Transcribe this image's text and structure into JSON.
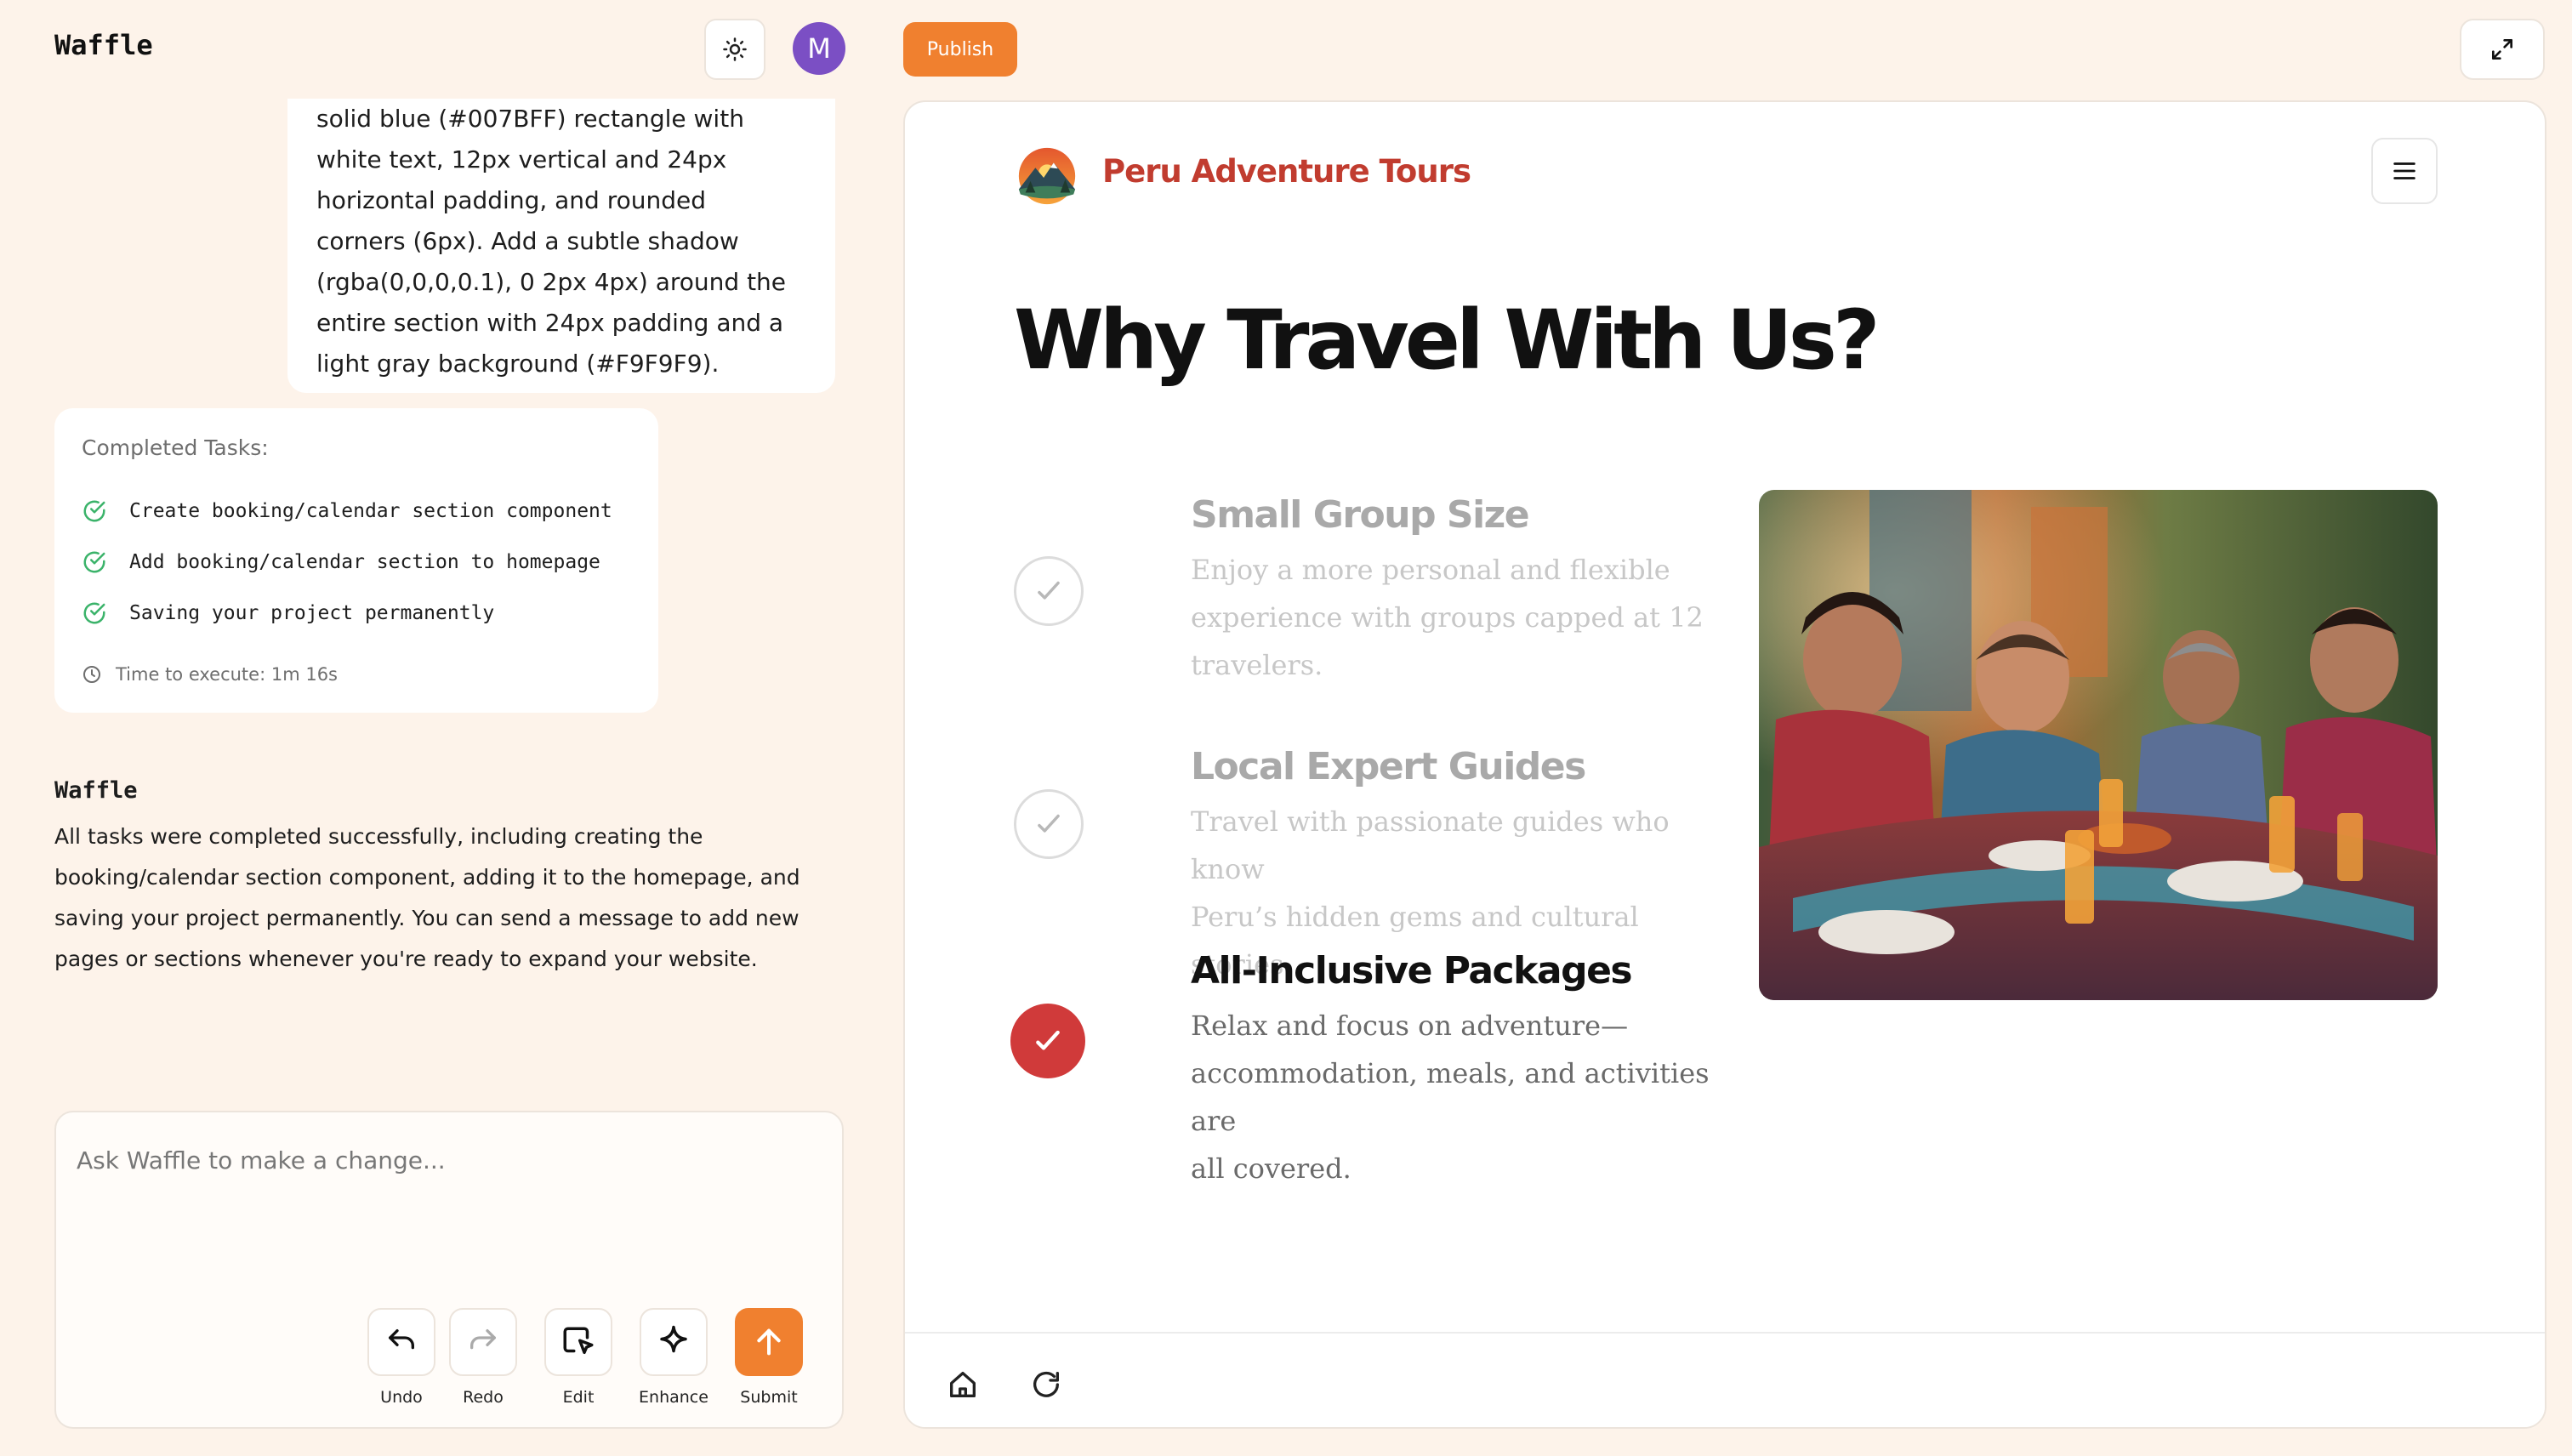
{
  "app": {
    "name": "Waffle",
    "avatar_initial": "M",
    "publish_label": "Publish"
  },
  "chat": {
    "user_message_lines": [
      "solid blue (#007BFF) rectangle with",
      "white text, 12px vertical and 24px",
      "horizontal padding, and rounded",
      "corners (6px). Add a subtle shadow",
      "(rgba(0,0,0,0.1), 0 2px 4px) around the",
      "entire section with 24px padding and a",
      "light gray background (#F9F9F9)."
    ],
    "tasks_title": "Completed Tasks:",
    "tasks": [
      "Create booking/calendar section component",
      "Add booking/calendar section to homepage",
      "Saving your project permanently"
    ],
    "exec_time": "Time to execute: 1m 16s",
    "reply_name": "Waffle",
    "reply_lines": [
      "All tasks were completed successfully, including creating the",
      "booking/calendar section component, adding it to the homepage, and",
      "saving your project permanently. You can send a message to add new",
      "pages or sections whenever you're ready to expand your website."
    ]
  },
  "composer": {
    "placeholder": "Ask Waffle to make a change...",
    "tools": [
      "Undo",
      "Redo",
      "Edit",
      "Enhance",
      "Submit"
    ]
  },
  "preview": {
    "site_name": "Peru Adventure Tours",
    "hero_title": "Why Travel With Us?",
    "features": [
      {
        "title": "Small Group Size",
        "lines": [
          "Enjoy a more personal and flexible",
          "experience with groups capped at 12",
          "travelers."
        ],
        "state": "dim"
      },
      {
        "title": "Local Expert Guides",
        "lines": [
          "Travel with passionate guides who know",
          "Peru’s hidden gems and cultural stories."
        ],
        "state": "dim"
      },
      {
        "title": "All-Inclusive Packages",
        "lines": [
          "Relax and focus on adventure—",
          "accommodation, meals, and activities are",
          "all covered."
        ],
        "state": "active"
      }
    ]
  },
  "colors": {
    "accent": "#f0802f",
    "brand_red": "#c13c2f",
    "active_check": "#d03a3a",
    "success_green": "#3bb36a",
    "avatar": "#7b4fc4"
  }
}
